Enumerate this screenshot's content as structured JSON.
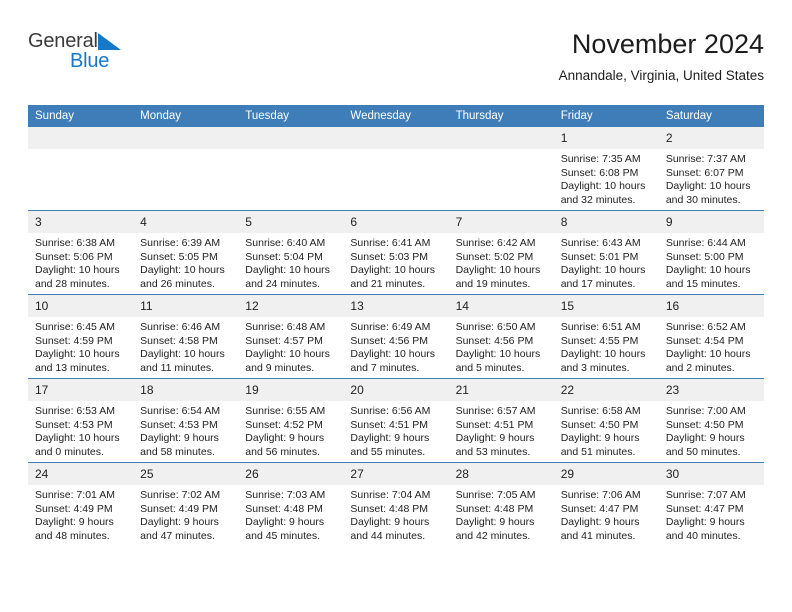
{
  "brand": {
    "name_top": "General",
    "name_bottom": "Blue",
    "triangle_icon": "blue-triangle-icon",
    "colors": {
      "top_text": "#3b3b3b",
      "bottom_text": "#1878c8",
      "triangle": "#1878c8"
    }
  },
  "header": {
    "title": "November 2024",
    "subtitle": "Annandale, Virginia, United States"
  },
  "theme": {
    "header_row_bg": "#3e7db8",
    "header_row_text": "#ffffff",
    "daynum_bg": "#f0f0f0",
    "row_divider": "#3e7db8",
    "cell_bg": "#ffffff",
    "body_text": "#222222"
  },
  "weekday_headers": [
    "Sunday",
    "Monday",
    "Tuesday",
    "Wednesday",
    "Thursday",
    "Friday",
    "Saturday"
  ],
  "weeks": [
    [
      {
        "day": "",
        "blank": true,
        "sunrise": "",
        "sunset": "",
        "daylight": ""
      },
      {
        "day": "",
        "blank": true,
        "sunrise": "",
        "sunset": "",
        "daylight": ""
      },
      {
        "day": "",
        "blank": true,
        "sunrise": "",
        "sunset": "",
        "daylight": ""
      },
      {
        "day": "",
        "blank": true,
        "sunrise": "",
        "sunset": "",
        "daylight": ""
      },
      {
        "day": "",
        "blank": true,
        "sunrise": "",
        "sunset": "",
        "daylight": ""
      },
      {
        "day": "1",
        "blank": false,
        "sunrise": "Sunrise: 7:35 AM",
        "sunset": "Sunset: 6:08 PM",
        "daylight": "Daylight: 10 hours and 32 minutes."
      },
      {
        "day": "2",
        "blank": false,
        "sunrise": "Sunrise: 7:37 AM",
        "sunset": "Sunset: 6:07 PM",
        "daylight": "Daylight: 10 hours and 30 minutes."
      }
    ],
    [
      {
        "day": "3",
        "blank": false,
        "sunrise": "Sunrise: 6:38 AM",
        "sunset": "Sunset: 5:06 PM",
        "daylight": "Daylight: 10 hours and 28 minutes."
      },
      {
        "day": "4",
        "blank": false,
        "sunrise": "Sunrise: 6:39 AM",
        "sunset": "Sunset: 5:05 PM",
        "daylight": "Daylight: 10 hours and 26 minutes."
      },
      {
        "day": "5",
        "blank": false,
        "sunrise": "Sunrise: 6:40 AM",
        "sunset": "Sunset: 5:04 PM",
        "daylight": "Daylight: 10 hours and 24 minutes."
      },
      {
        "day": "6",
        "blank": false,
        "sunrise": "Sunrise: 6:41 AM",
        "sunset": "Sunset: 5:03 PM",
        "daylight": "Daylight: 10 hours and 21 minutes."
      },
      {
        "day": "7",
        "blank": false,
        "sunrise": "Sunrise: 6:42 AM",
        "sunset": "Sunset: 5:02 PM",
        "daylight": "Daylight: 10 hours and 19 minutes."
      },
      {
        "day": "8",
        "blank": false,
        "sunrise": "Sunrise: 6:43 AM",
        "sunset": "Sunset: 5:01 PM",
        "daylight": "Daylight: 10 hours and 17 minutes."
      },
      {
        "day": "9",
        "blank": false,
        "sunrise": "Sunrise: 6:44 AM",
        "sunset": "Sunset: 5:00 PM",
        "daylight": "Daylight: 10 hours and 15 minutes."
      }
    ],
    [
      {
        "day": "10",
        "blank": false,
        "sunrise": "Sunrise: 6:45 AM",
        "sunset": "Sunset: 4:59 PM",
        "daylight": "Daylight: 10 hours and 13 minutes."
      },
      {
        "day": "11",
        "blank": false,
        "sunrise": "Sunrise: 6:46 AM",
        "sunset": "Sunset: 4:58 PM",
        "daylight": "Daylight: 10 hours and 11 minutes."
      },
      {
        "day": "12",
        "blank": false,
        "sunrise": "Sunrise: 6:48 AM",
        "sunset": "Sunset: 4:57 PM",
        "daylight": "Daylight: 10 hours and 9 minutes."
      },
      {
        "day": "13",
        "blank": false,
        "sunrise": "Sunrise: 6:49 AM",
        "sunset": "Sunset: 4:56 PM",
        "daylight": "Daylight: 10 hours and 7 minutes."
      },
      {
        "day": "14",
        "blank": false,
        "sunrise": "Sunrise: 6:50 AM",
        "sunset": "Sunset: 4:56 PM",
        "daylight": "Daylight: 10 hours and 5 minutes."
      },
      {
        "day": "15",
        "blank": false,
        "sunrise": "Sunrise: 6:51 AM",
        "sunset": "Sunset: 4:55 PM",
        "daylight": "Daylight: 10 hours and 3 minutes."
      },
      {
        "day": "16",
        "blank": false,
        "sunrise": "Sunrise: 6:52 AM",
        "sunset": "Sunset: 4:54 PM",
        "daylight": "Daylight: 10 hours and 2 minutes."
      }
    ],
    [
      {
        "day": "17",
        "blank": false,
        "sunrise": "Sunrise: 6:53 AM",
        "sunset": "Sunset: 4:53 PM",
        "daylight": "Daylight: 10 hours and 0 minutes."
      },
      {
        "day": "18",
        "blank": false,
        "sunrise": "Sunrise: 6:54 AM",
        "sunset": "Sunset: 4:53 PM",
        "daylight": "Daylight: 9 hours and 58 minutes."
      },
      {
        "day": "19",
        "blank": false,
        "sunrise": "Sunrise: 6:55 AM",
        "sunset": "Sunset: 4:52 PM",
        "daylight": "Daylight: 9 hours and 56 minutes."
      },
      {
        "day": "20",
        "blank": false,
        "sunrise": "Sunrise: 6:56 AM",
        "sunset": "Sunset: 4:51 PM",
        "daylight": "Daylight: 9 hours and 55 minutes."
      },
      {
        "day": "21",
        "blank": false,
        "sunrise": "Sunrise: 6:57 AM",
        "sunset": "Sunset: 4:51 PM",
        "daylight": "Daylight: 9 hours and 53 minutes."
      },
      {
        "day": "22",
        "blank": false,
        "sunrise": "Sunrise: 6:58 AM",
        "sunset": "Sunset: 4:50 PM",
        "daylight": "Daylight: 9 hours and 51 minutes."
      },
      {
        "day": "23",
        "blank": false,
        "sunrise": "Sunrise: 7:00 AM",
        "sunset": "Sunset: 4:50 PM",
        "daylight": "Daylight: 9 hours and 50 minutes."
      }
    ],
    [
      {
        "day": "24",
        "blank": false,
        "sunrise": "Sunrise: 7:01 AM",
        "sunset": "Sunset: 4:49 PM",
        "daylight": "Daylight: 9 hours and 48 minutes."
      },
      {
        "day": "25",
        "blank": false,
        "sunrise": "Sunrise: 7:02 AM",
        "sunset": "Sunset: 4:49 PM",
        "daylight": "Daylight: 9 hours and 47 minutes."
      },
      {
        "day": "26",
        "blank": false,
        "sunrise": "Sunrise: 7:03 AM",
        "sunset": "Sunset: 4:48 PM",
        "daylight": "Daylight: 9 hours and 45 minutes."
      },
      {
        "day": "27",
        "blank": false,
        "sunrise": "Sunrise: 7:04 AM",
        "sunset": "Sunset: 4:48 PM",
        "daylight": "Daylight: 9 hours and 44 minutes."
      },
      {
        "day": "28",
        "blank": false,
        "sunrise": "Sunrise: 7:05 AM",
        "sunset": "Sunset: 4:48 PM",
        "daylight": "Daylight: 9 hours and 42 minutes."
      },
      {
        "day": "29",
        "blank": false,
        "sunrise": "Sunrise: 7:06 AM",
        "sunset": "Sunset: 4:47 PM",
        "daylight": "Daylight: 9 hours and 41 minutes."
      },
      {
        "day": "30",
        "blank": false,
        "sunrise": "Sunrise: 7:07 AM",
        "sunset": "Sunset: 4:47 PM",
        "daylight": "Daylight: 9 hours and 40 minutes."
      }
    ]
  ]
}
